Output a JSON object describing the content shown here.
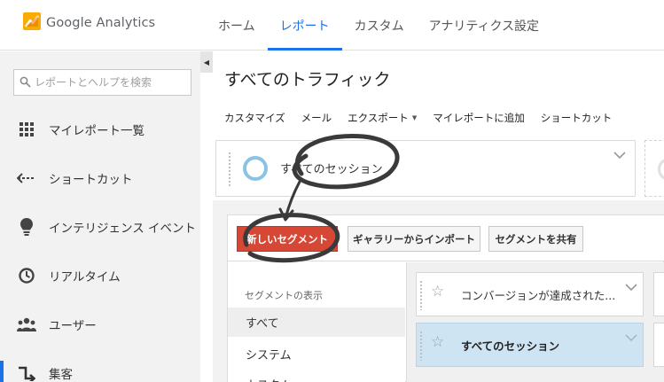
{
  "app": {
    "name": "Google Analytics",
    "brand_color": "#f9ab00",
    "accent_color": "#1a73e8"
  },
  "nav": {
    "tabs": [
      {
        "label": "ホーム",
        "active": false
      },
      {
        "label": "レポート",
        "active": true
      },
      {
        "label": "カスタム",
        "active": false
      },
      {
        "label": "アナリティクス設定",
        "active": false
      }
    ]
  },
  "sidebar": {
    "search_placeholder": "レポートとヘルプを検索",
    "collapse_icon": "chevron-left-icon",
    "items": [
      {
        "label": "マイレポート一覧",
        "icon": "grid-icon"
      },
      {
        "label": "ショートカット",
        "icon": "shortcut-arrow-icon"
      },
      {
        "label": "インテリジェンス イベント",
        "icon": "lightbulb-icon"
      },
      {
        "label": "リアルタイム",
        "icon": "clock-icon"
      },
      {
        "label": "ユーザー",
        "icon": "people-icon"
      },
      {
        "label": "集客",
        "icon": "acquisition-icon",
        "active": true
      }
    ]
  },
  "main": {
    "title": "すべてのトラフィック",
    "toolbar": [
      {
        "label": "カスタマイズ"
      },
      {
        "label": "メール"
      },
      {
        "label": "エクスポート",
        "dropdown": true
      },
      {
        "label": "マイレポートに追加"
      },
      {
        "label": "ショートカット"
      }
    ],
    "segment_card": {
      "label": "すべてのセッション",
      "ring_color": "#8ac3e6"
    },
    "segment_panel": {
      "new_segment_button": "新しいセグメント",
      "import_button": "ギャラリーからインポート",
      "share_button": "セグメントを共有",
      "left_header": "セグメントの表示",
      "left_items": [
        {
          "label": "すべて",
          "selected": true
        },
        {
          "label": "システム",
          "selected": false
        },
        {
          "label": "カスタム",
          "selected": false
        }
      ],
      "options": [
        {
          "label": "コンバージョンが達成された...",
          "selected": false
        },
        {
          "label": "すべてのセッション",
          "selected": true
        }
      ]
    }
  }
}
